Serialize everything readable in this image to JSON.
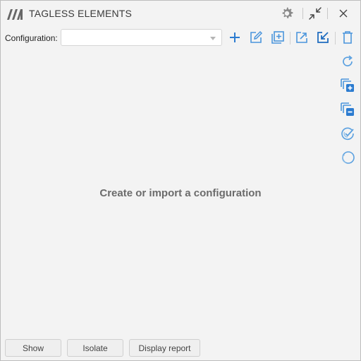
{
  "window": {
    "title": "TAGLESS ELEMENTS"
  },
  "titlebar": {
    "icons": [
      "app-logo",
      "gear-icon",
      "collapse-icon",
      "close-icon"
    ]
  },
  "config": {
    "label": "Configuration:",
    "selected_value": ""
  },
  "toolbar": {
    "icons": [
      "add-icon",
      "edit-icon",
      "duplicate-icon",
      "export-icon",
      "import-icon",
      "delete-icon"
    ]
  },
  "side_toolbar": {
    "icons": [
      "refresh-icon",
      "add-to-selection-icon",
      "remove-from-selection-icon",
      "check-circle-icon",
      "circle-icon"
    ]
  },
  "main": {
    "empty_message": "Create or import a configuration"
  },
  "footer": {
    "show_label": "Show",
    "isolate_label": "Isolate",
    "report_label": "Display report"
  },
  "colors": {
    "accent": "#2b7bd0",
    "accent_light": "#5aa0e0",
    "muted_text": "#6b6b6b",
    "background": "#f3f3f3"
  }
}
